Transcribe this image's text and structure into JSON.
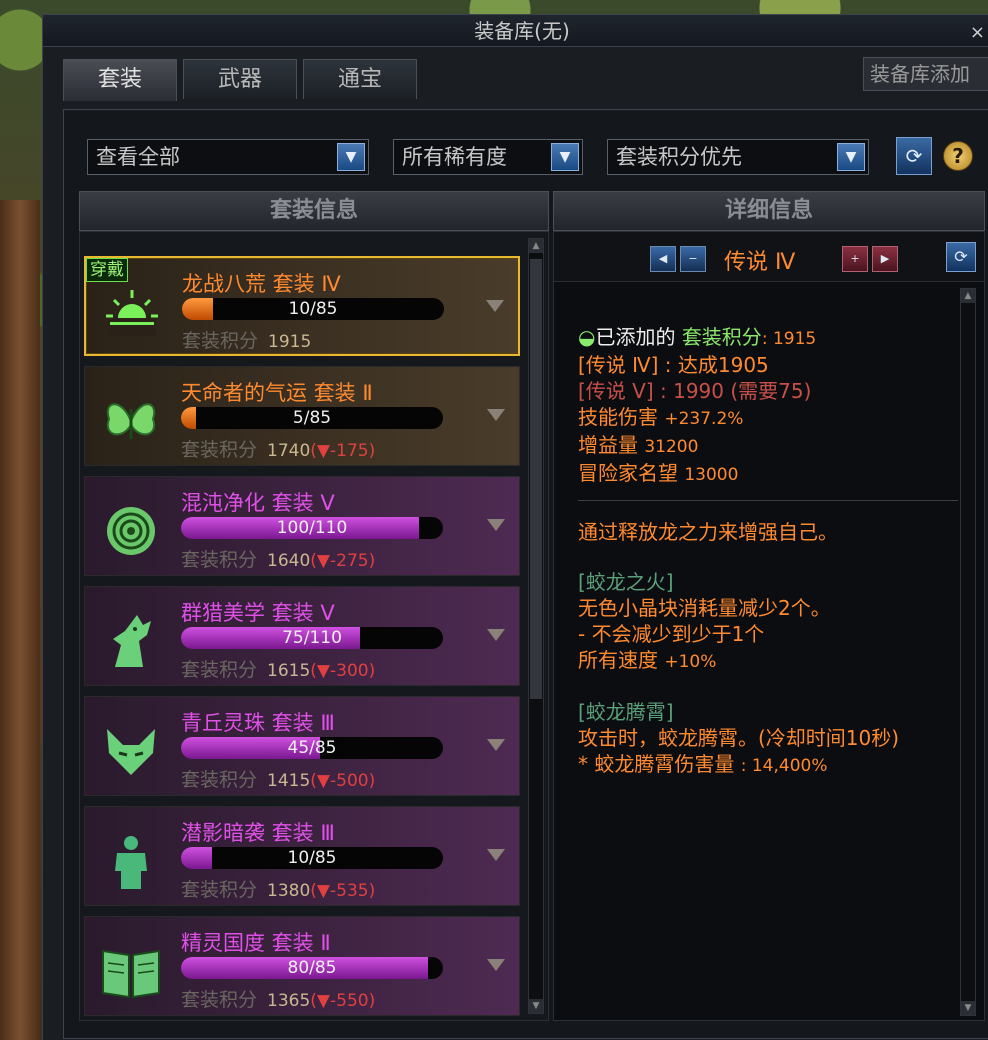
{
  "window": {
    "title": "装备库(无)",
    "close": "×"
  },
  "tabs": [
    {
      "label": "套装",
      "active": true
    },
    {
      "label": "武器",
      "active": false
    },
    {
      "label": "通宝",
      "active": false
    }
  ],
  "add_library_button": "装备库添加",
  "filters": {
    "category": "查看全部",
    "rarity": "所有稀有度",
    "sort": "套装积分优先"
  },
  "panels": {
    "list_header": "套装信息",
    "detail_header": "详细信息"
  },
  "sets": [
    {
      "name": "龙战八荒 套装 Ⅳ",
      "progress": "10/85",
      "fill_pct": 11.8,
      "score_label": "套装积分",
      "score": "1915",
      "diff": "",
      "theme": "brown",
      "name_color": "orange",
      "badge": "穿戴",
      "selected": true,
      "icon": "sun-icon"
    },
    {
      "name": "天命者的气运 套装 Ⅱ",
      "progress": "5/85",
      "fill_pct": 5.9,
      "score_label": "套装积分",
      "score": "1740",
      "diff": "(▼-175)",
      "theme": "brown",
      "name_color": "orange",
      "icon": "butterfly-icon"
    },
    {
      "name": "混沌净化 套装 Ⅴ",
      "progress": "100/110",
      "fill_pct": 90.9,
      "score_label": "套装积分",
      "score": "1640",
      "diff": "(▼-275)",
      "theme": "purple",
      "name_color": "magenta",
      "icon": "rose-icon"
    },
    {
      "name": "群猎美学 套装 Ⅴ",
      "progress": "75/110",
      "fill_pct": 68.2,
      "score_label": "套装积分",
      "score": "1615",
      "diff": "(▼-300)",
      "theme": "purple",
      "name_color": "magenta",
      "icon": "wolf-icon"
    },
    {
      "name": "青丘灵珠 套装 Ⅲ",
      "progress": "45/85",
      "fill_pct": 52.9,
      "score_label": "套装积分",
      "score": "1415",
      "diff": "(▼-500)",
      "theme": "purple",
      "name_color": "magenta",
      "icon": "fox-icon"
    },
    {
      "name": "潜影暗袭 套装 Ⅲ",
      "progress": "10/85",
      "fill_pct": 11.8,
      "score_label": "套装积分",
      "score": "1380",
      "diff": "(▼-535)",
      "theme": "purple",
      "name_color": "magenta",
      "icon": "figure-icon"
    },
    {
      "name": "精灵国度 套装 Ⅱ",
      "progress": "80/85",
      "fill_pct": 94.1,
      "score_label": "套装积分",
      "score": "1365",
      "diff": "(▼-550)",
      "theme": "purple",
      "name_color": "magenta",
      "icon": "book-icon"
    }
  ],
  "detail": {
    "level": "传说 Ⅳ",
    "added_prefix": "已添加的",
    "added_label": "套装积分",
    "added_value": ": 1915",
    "achieved": "[传说 Ⅳ] : 达成1905",
    "next_level": "[传说 Ⅴ] : 1990 (需要75)",
    "skill_damage_label": "技能伤害",
    "skill_damage": "+237.2%",
    "buff_label": "增益量",
    "buff": "31200",
    "fame_label": "冒险家名望",
    "fame": "13000",
    "description": "通过释放龙之力来增强自己。",
    "effect1_title": "[蛟龙之火]",
    "effect1_line1": "无色小晶块消耗量减少2个。",
    "effect1_line2": "- 不会减少到少于1个",
    "effect1_line3_label": "所有速度",
    "effect1_line3_value": "+10%",
    "effect2_title": "[蛟龙腾霄]",
    "effect2_line1": "攻击时，蛟龙腾霄。(冷却时间10秒)",
    "effect2_line2_label": "* 蛟龙腾霄伤害量",
    "effect2_line2_value": ": 14,400%"
  },
  "colors": {
    "orange": "#ff8a30",
    "magenta": "#e050e8",
    "green": "#8ae86a",
    "gold_border": "#e8b830",
    "red_diff": "#e04040"
  }
}
